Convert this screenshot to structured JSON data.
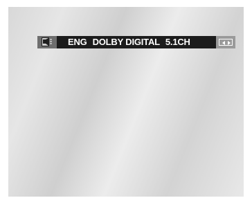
{
  "osd": {
    "language": "ENG",
    "audio_format": "DOLBY DIGITAL",
    "channels": "5.1CH",
    "icon": "audio-icon",
    "navigation": "left-right-arrows-icon"
  }
}
